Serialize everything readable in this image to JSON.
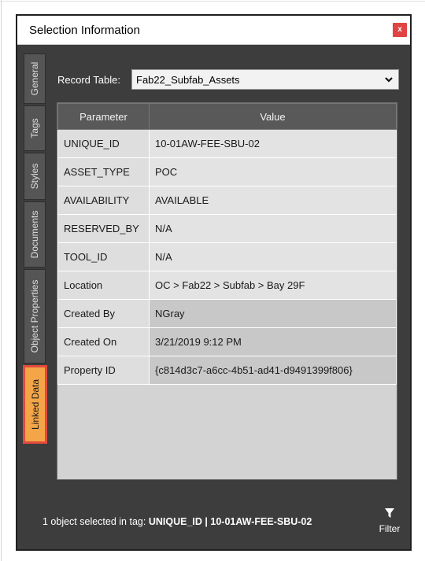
{
  "window": {
    "title": "Selection Information",
    "close_label": "x"
  },
  "tabs": [
    {
      "label": "General",
      "active": false
    },
    {
      "label": "Tags",
      "active": false
    },
    {
      "label": "Styles",
      "active": false
    },
    {
      "label": "Documents",
      "active": false
    },
    {
      "label": "Object Properties",
      "active": false
    },
    {
      "label": "Linked Data",
      "active": true
    }
  ],
  "record_table": {
    "label": "Record Table:",
    "selected": "Fab22_Subfab_Assets"
  },
  "grid": {
    "columns": [
      "Parameter",
      "Value"
    ],
    "rows": [
      {
        "parameter": "UNIQUE_ID",
        "value": "10-01AW-FEE-SBU-02"
      },
      {
        "parameter": "ASSET_TYPE",
        "value": "POC"
      },
      {
        "parameter": "AVAILABILITY",
        "value": "AVAILABLE"
      },
      {
        "parameter": "RESERVED_BY",
        "value": "N/A"
      },
      {
        "parameter": "TOOL_ID",
        "value": "N/A"
      },
      {
        "parameter": "Location",
        "value": "OC > Fab22 > Subfab > Bay 29F"
      },
      {
        "parameter": "Created By",
        "value": "NGray"
      },
      {
        "parameter": "Created On",
        "value": "3/21/2019 9:12 PM"
      },
      {
        "parameter": "Property ID",
        "value": "{c814d3c7-a6cc-4b51-ad41-d9491399f806}"
      }
    ]
  },
  "status": {
    "prefix": "1 object selected in tag:",
    "tag_name": "UNIQUE_ID",
    "separator": "|",
    "tag_value": "10-01AW-FEE-SBU-02"
  },
  "filter": {
    "label": "Filter",
    "icon": "funnel-icon"
  },
  "colors": {
    "panel_bg": "#3d3d3d",
    "active_tab": "#f4a547",
    "active_tab_border": "#e34a3e",
    "close_button": "#e04343"
  }
}
